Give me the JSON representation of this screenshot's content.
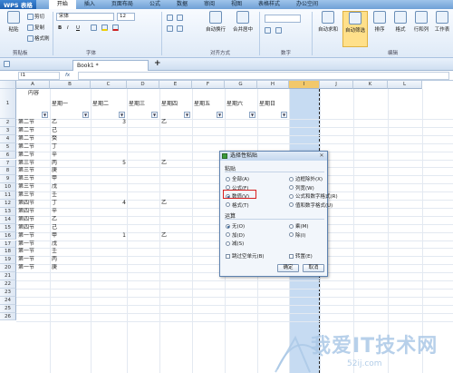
{
  "app": {
    "name": "WPS 表格"
  },
  "menus": [
    "开始",
    "插入",
    "页面布局",
    "公式",
    "数据",
    "审阅",
    "视图",
    "表格样式",
    "办公空间"
  ],
  "ribbon": {
    "paste": "粘贴",
    "cut": "剪切",
    "copy": "复制",
    "format_painter": "格式刷",
    "font_name": "宋体",
    "font_size": "12",
    "bold": "B",
    "italic": "I",
    "underline": "U",
    "wrap": "自动换行",
    "merge": "合并居中",
    "autosum": "自动求和",
    "autofilter": "自动筛选",
    "sort": "排序",
    "format": "格式",
    "rowcol": "行和列",
    "worksheet": "工作表",
    "groups": {
      "clipboard": "剪贴板",
      "font": "字体",
      "alignment": "对齐方式",
      "number": "数字",
      "edit": "编辑"
    }
  },
  "tabs": {
    "doc": "Book1 *"
  },
  "formula_bar": {
    "cell_ref": "I1",
    "fx": "fx"
  },
  "grid": {
    "columns": [
      "A",
      "B",
      "C",
      "D",
      "E",
      "F",
      "G",
      "H",
      "I",
      "J",
      "K",
      "L"
    ],
    "row_numbers": [
      "1",
      "2",
      "3",
      "4",
      "5",
      "6",
      "7",
      "8",
      "9",
      "10",
      "11",
      "12",
      "13",
      "14",
      "15",
      "16",
      "17",
      "18",
      "19",
      "20",
      "21",
      "22",
      "23",
      "24",
      "25",
      "26"
    ],
    "header_row": {
      "A": "内容",
      "B": "星期一",
      "C": "星期二",
      "D": "星期三",
      "E": "星期四",
      "F": "星期五",
      "G": "星期六",
      "H": "星期日"
    },
    "col_a": [
      "第二节",
      "第二节",
      "第二节",
      "第二节",
      "第二节",
      "第三节",
      "第三节",
      "第三节",
      "第三节",
      "第三节",
      "第四节",
      "第四节",
      "第四节",
      "第四节",
      "第一节",
      "第一节",
      "第一节",
      "第一节",
      "第一节"
    ],
    "col_b": [
      "乙",
      "己",
      "癸",
      "丁",
      "辛",
      "丙",
      "庚",
      "甲",
      "戊",
      "壬",
      "丁",
      "辛",
      "乙",
      "己",
      "甲",
      "戊",
      "壬",
      "丙",
      "庚"
    ],
    "col_c": {
      "2": "3",
      "7": "5",
      "12": "4",
      "16": "1"
    },
    "col_e": {
      "2": "乙",
      "7": "乙",
      "12": "乙",
      "16": "乙"
    }
  },
  "dialog": {
    "title": "选择性粘贴",
    "paste_section": "粘贴",
    "paste_left": [
      "全部(A)",
      "公式(F)",
      "数值(V)",
      "格式(T)"
    ],
    "paste_right": [
      "边框除外(X)",
      "列宽(W)",
      "公式和数字格式(R)",
      "值和数字格式(U)"
    ],
    "selected_paste": "数值(V)",
    "op_section": "运算",
    "op_left": [
      "无(O)",
      "加(D)",
      "减(S)"
    ],
    "op_right": [
      "乘(M)",
      "除(I)"
    ],
    "selected_op": "无(O)",
    "skip_blanks": "跳过空单元(B)",
    "transpose": "转置(E)",
    "ok": "确定",
    "cancel": "取消"
  },
  "watermark": {
    "text": "我爱IT技术网",
    "sub": "52ij.com"
  }
}
